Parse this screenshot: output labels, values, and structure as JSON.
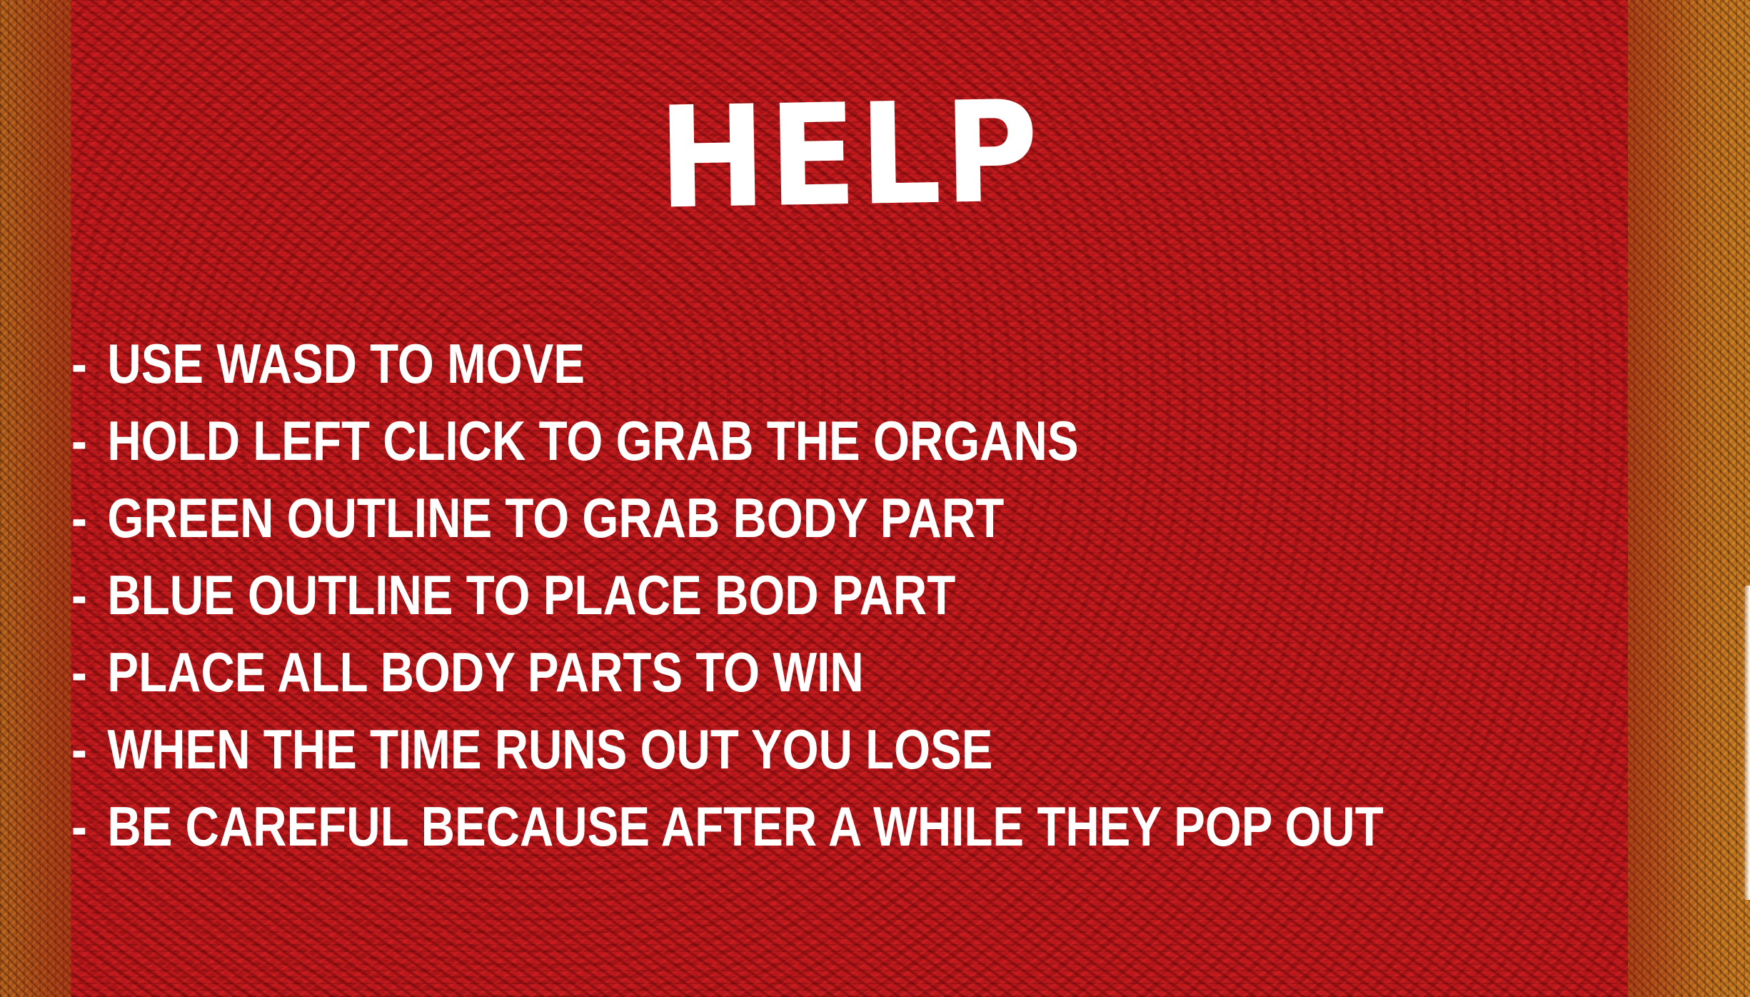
{
  "screen": {
    "title": "HELP",
    "rules": [
      "USE WASD TO MOVE",
      "HOLD LEFT CLICK TO GRAB THE ORGANS",
      "GREEN OUTLINE TO GRAB BODY PART",
      "BLUE OUTLINE TO PLACE BOD PART",
      "PLACE ALL BODY PARTS TO WIN",
      "WHEN THE TIME RUNS OUT YOU LOSE",
      "BE CAREFUL BECAUSE AFTER A WHILE THEY POP OUT"
    ],
    "bullet": "-"
  },
  "colors": {
    "panel": "#b8181c",
    "border": "#9a5a1a",
    "text": "#ffffff"
  }
}
